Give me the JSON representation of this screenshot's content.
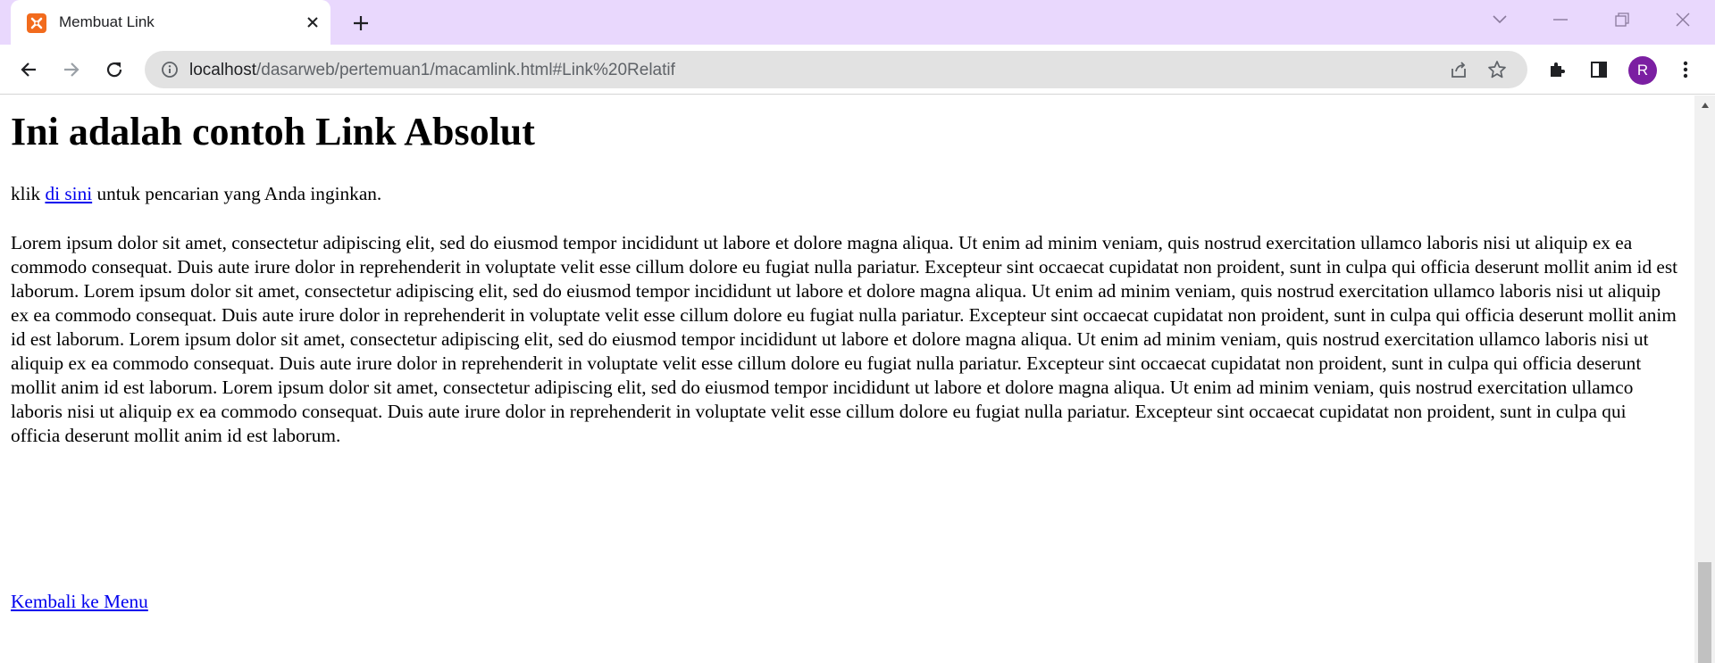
{
  "browser": {
    "tab": {
      "title": "Membuat Link",
      "favicon": "xampp-icon"
    },
    "url": {
      "host": "localhost",
      "path": "/dasarweb/pertemuan1/macamlink.html#Link%20Relatif"
    },
    "profile_initial": "R"
  },
  "colors": {
    "tabstrip": "#e9d8fd",
    "omnibox": "#e2e2e2",
    "link": "#0000ee",
    "avatar": "#7b1fa2",
    "favicon": "#f26b1d"
  },
  "page": {
    "heading": "Ini adalah contoh Link Absolut",
    "intro_prefix": "klik ",
    "intro_link": "di sini",
    "intro_suffix": " untuk pencarian yang Anda inginkan.",
    "lorem": "Lorem ipsum dolor sit amet, consectetur adipiscing elit, sed do eiusmod tempor incididunt ut labore et dolore magna aliqua. Ut enim ad minim veniam, quis nostrud exercitation ullamco laboris nisi ut aliquip ex ea commodo consequat. Duis aute irure dolor in reprehenderit in voluptate velit esse cillum dolore eu fugiat nulla pariatur. Excepteur sint occaecat cupidatat non proident, sunt in culpa qui officia deserunt mollit anim id est laborum. Lorem ipsum dolor sit amet, consectetur adipiscing elit, sed do eiusmod tempor incididunt ut labore et dolore magna aliqua. Ut enim ad minim veniam, quis nostrud exercitation ullamco laboris nisi ut aliquip ex ea commodo consequat. Duis aute irure dolor in reprehenderit in voluptate velit esse cillum dolore eu fugiat nulla pariatur. Excepteur sint occaecat cupidatat non proident, sunt in culpa qui officia deserunt mollit anim id est laborum. Lorem ipsum dolor sit amet, consectetur adipiscing elit, sed do eiusmod tempor incididunt ut labore et dolore magna aliqua. Ut enim ad minim veniam, quis nostrud exercitation ullamco laboris nisi ut aliquip ex ea commodo consequat. Duis aute irure dolor in reprehenderit in voluptate velit esse cillum dolore eu fugiat nulla pariatur. Excepteur sint occaecat cupidatat non proident, sunt in culpa qui officia deserunt mollit anim id est laborum. Lorem ipsum dolor sit amet, consectetur adipiscing elit, sed do eiusmod tempor incididunt ut labore et dolore magna aliqua. Ut enim ad minim veniam, quis nostrud exercitation ullamco laboris nisi ut aliquip ex ea commodo consequat. Duis aute irure dolor in reprehenderit in voluptate velit esse cillum dolore eu fugiat nulla pariatur. Excepteur sint occaecat cupidatat non proident, sunt in culpa qui officia deserunt mollit anim id est laborum.",
    "back_link": "Kembali ke Menu"
  },
  "scrollbar": {
    "position": 0.82
  }
}
